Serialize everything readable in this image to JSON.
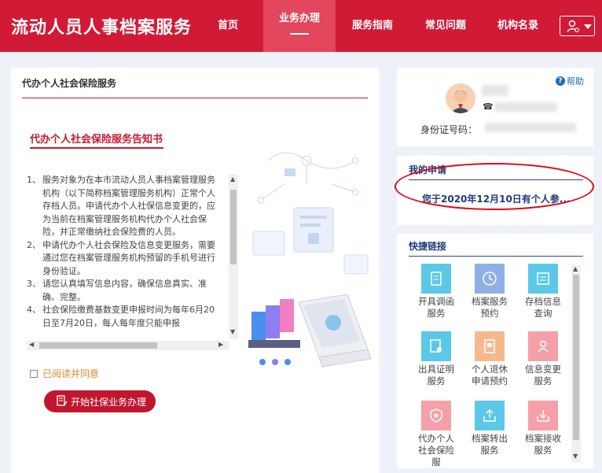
{
  "header": {
    "brand": "流动人员人事档案服务",
    "nav": [
      {
        "label": "首页"
      },
      {
        "label": "业务办理"
      },
      {
        "label": "服务指南"
      },
      {
        "label": "常见问题"
      },
      {
        "label": "机构名录"
      }
    ],
    "active_index": 1,
    "colors": {
      "primary": "#d11a36",
      "active_bg": "#e2475e"
    }
  },
  "left": {
    "panel_title": "代办个人社会保险服务",
    "notice_title": "代办个人社会保险服务告知书",
    "notice_items": [
      {
        "num": "1、",
        "text": "服务对象为在本市流动人员人事档案管理服务机构（以下简称档案管理服务机构）正常个人存档人员。申请代办个人社保信息变更的，应为当前在档案管理服务机构代办个人社会保险，并正常缴纳社会保险费的人员。"
      },
      {
        "num": "2、",
        "text": "申请代办个人社会保险及信息变更服务，需要通过您在档案管理服务机构预留的手机号进行身份验证。"
      },
      {
        "num": "3、",
        "text": "请您认真填写信息内容，确保信息真实、准确、完整。"
      },
      {
        "num": "4、",
        "text": "社会保险缴费基数变更申报时间为每年6月20日至7月20日，每人每年度只能申报"
      }
    ],
    "agree_label": "已阅读并同意",
    "start_button": "开始社保业务办理"
  },
  "profile": {
    "help_label": "帮助",
    "id_label": "身份证号码："
  },
  "my_apply": {
    "title": "我的申请",
    "item": "您于2020年12月10日有个人参..."
  },
  "quick_links": {
    "title": "快捷链接",
    "tiles": [
      {
        "label": "开具调函服务",
        "icon": "document-icon",
        "color": "#5cc8e8"
      },
      {
        "label": "档案服务预约",
        "icon": "clock-icon",
        "color": "#8fb0e6"
      },
      {
        "label": "存档信息查询",
        "icon": "inbox-icon",
        "color": "#5cc8e8"
      },
      {
        "label": "出具证明服务",
        "icon": "certificate-icon",
        "color": "#5cc8e8"
      },
      {
        "label": "个人退休申请预约",
        "icon": "form-icon",
        "color": "#f6b98e"
      },
      {
        "label": "信息变更服务",
        "icon": "person-icon",
        "color": "#f5a0a8"
      },
      {
        "label": "代办个人社会保险服",
        "icon": "shield-icon",
        "color": "#f5a0a8"
      },
      {
        "label": "档案转出服务",
        "icon": "export-icon",
        "color": "#5cc8e8"
      },
      {
        "label": "档案接收服务",
        "icon": "import-icon",
        "color": "#f5a0a8"
      }
    ]
  }
}
